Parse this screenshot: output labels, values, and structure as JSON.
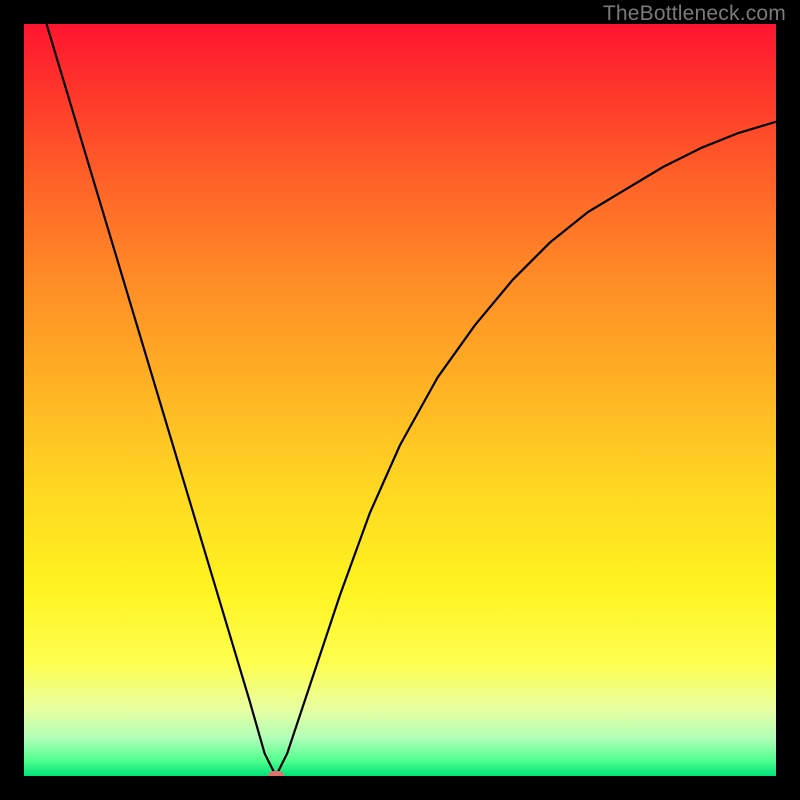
{
  "watermark": "TheBottleneck.com",
  "chart_data": {
    "type": "line",
    "title": "",
    "xlabel": "",
    "ylabel": "",
    "xlim": [
      0,
      100
    ],
    "ylim": [
      0,
      100
    ],
    "grid": false,
    "legend": false,
    "background_gradient": {
      "top": "#ff1530",
      "mid": "#ffd822",
      "bottom": "#00e278"
    },
    "series": [
      {
        "name": "bottleneck-curve",
        "color": "#000000",
        "x": [
          3,
          6,
          9,
          12,
          15,
          18,
          21,
          24,
          27,
          30,
          32,
          33.5,
          35,
          38,
          42,
          46,
          50,
          55,
          60,
          65,
          70,
          75,
          80,
          85,
          90,
          95,
          100
        ],
        "y": [
          100,
          90,
          80,
          70,
          60,
          50,
          40,
          30,
          20,
          10,
          3,
          0,
          3,
          12,
          24,
          35,
          44,
          53,
          60,
          66,
          71,
          75,
          78,
          81,
          83.5,
          85.5,
          87
        ]
      }
    ],
    "marker": {
      "name": "optimal-point",
      "color": "#e0736b",
      "x": 33.5,
      "y": 0
    }
  }
}
